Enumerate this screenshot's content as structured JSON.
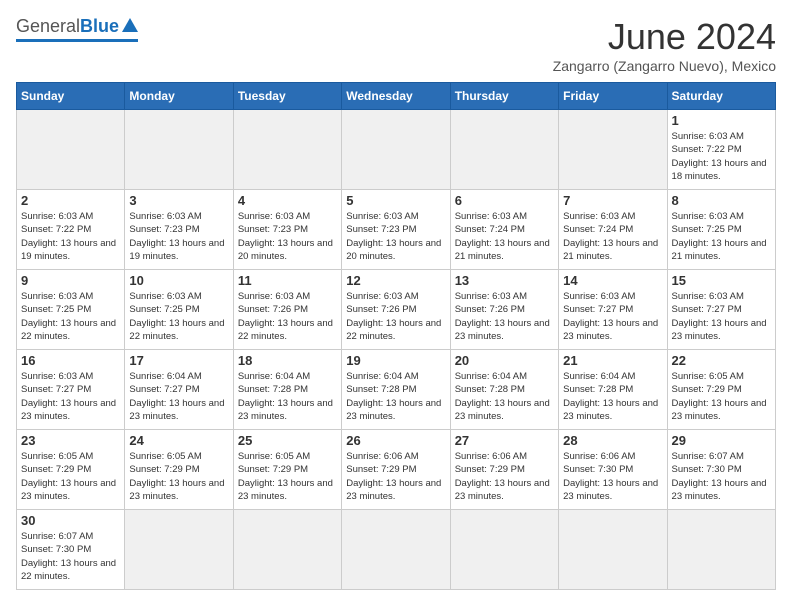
{
  "header": {
    "logo_general": "General",
    "logo_blue": "Blue",
    "title": "June 2024",
    "subtitle": "Zangarro (Zangarro Nuevo), Mexico"
  },
  "days_of_week": [
    "Sunday",
    "Monday",
    "Tuesday",
    "Wednesday",
    "Thursday",
    "Friday",
    "Saturday"
  ],
  "weeks": [
    [
      {
        "day": "",
        "info": ""
      },
      {
        "day": "",
        "info": ""
      },
      {
        "day": "",
        "info": ""
      },
      {
        "day": "",
        "info": ""
      },
      {
        "day": "",
        "info": ""
      },
      {
        "day": "",
        "info": ""
      },
      {
        "day": "1",
        "info": "Sunrise: 6:03 AM\nSunset: 7:22 PM\nDaylight: 13 hours and 18 minutes."
      }
    ],
    [
      {
        "day": "2",
        "info": "Sunrise: 6:03 AM\nSunset: 7:22 PM\nDaylight: 13 hours and 19 minutes."
      },
      {
        "day": "3",
        "info": "Sunrise: 6:03 AM\nSunset: 7:23 PM\nDaylight: 13 hours and 19 minutes."
      },
      {
        "day": "4",
        "info": "Sunrise: 6:03 AM\nSunset: 7:23 PM\nDaylight: 13 hours and 20 minutes."
      },
      {
        "day": "5",
        "info": "Sunrise: 6:03 AM\nSunset: 7:23 PM\nDaylight: 13 hours and 20 minutes."
      },
      {
        "day": "6",
        "info": "Sunrise: 6:03 AM\nSunset: 7:24 PM\nDaylight: 13 hours and 21 minutes."
      },
      {
        "day": "7",
        "info": "Sunrise: 6:03 AM\nSunset: 7:24 PM\nDaylight: 13 hours and 21 minutes."
      },
      {
        "day": "8",
        "info": "Sunrise: 6:03 AM\nSunset: 7:25 PM\nDaylight: 13 hours and 21 minutes."
      }
    ],
    [
      {
        "day": "9",
        "info": "Sunrise: 6:03 AM\nSunset: 7:25 PM\nDaylight: 13 hours and 22 minutes."
      },
      {
        "day": "10",
        "info": "Sunrise: 6:03 AM\nSunset: 7:25 PM\nDaylight: 13 hours and 22 minutes."
      },
      {
        "day": "11",
        "info": "Sunrise: 6:03 AM\nSunset: 7:26 PM\nDaylight: 13 hours and 22 minutes."
      },
      {
        "day": "12",
        "info": "Sunrise: 6:03 AM\nSunset: 7:26 PM\nDaylight: 13 hours and 22 minutes."
      },
      {
        "day": "13",
        "info": "Sunrise: 6:03 AM\nSunset: 7:26 PM\nDaylight: 13 hours and 23 minutes."
      },
      {
        "day": "14",
        "info": "Sunrise: 6:03 AM\nSunset: 7:27 PM\nDaylight: 13 hours and 23 minutes."
      },
      {
        "day": "15",
        "info": "Sunrise: 6:03 AM\nSunset: 7:27 PM\nDaylight: 13 hours and 23 minutes."
      }
    ],
    [
      {
        "day": "16",
        "info": "Sunrise: 6:03 AM\nSunset: 7:27 PM\nDaylight: 13 hours and 23 minutes."
      },
      {
        "day": "17",
        "info": "Sunrise: 6:04 AM\nSunset: 7:27 PM\nDaylight: 13 hours and 23 minutes."
      },
      {
        "day": "18",
        "info": "Sunrise: 6:04 AM\nSunset: 7:28 PM\nDaylight: 13 hours and 23 minutes."
      },
      {
        "day": "19",
        "info": "Sunrise: 6:04 AM\nSunset: 7:28 PM\nDaylight: 13 hours and 23 minutes."
      },
      {
        "day": "20",
        "info": "Sunrise: 6:04 AM\nSunset: 7:28 PM\nDaylight: 13 hours and 23 minutes."
      },
      {
        "day": "21",
        "info": "Sunrise: 6:04 AM\nSunset: 7:28 PM\nDaylight: 13 hours and 23 minutes."
      },
      {
        "day": "22",
        "info": "Sunrise: 6:05 AM\nSunset: 7:29 PM\nDaylight: 13 hours and 23 minutes."
      }
    ],
    [
      {
        "day": "23",
        "info": "Sunrise: 6:05 AM\nSunset: 7:29 PM\nDaylight: 13 hours and 23 minutes."
      },
      {
        "day": "24",
        "info": "Sunrise: 6:05 AM\nSunset: 7:29 PM\nDaylight: 13 hours and 23 minutes."
      },
      {
        "day": "25",
        "info": "Sunrise: 6:05 AM\nSunset: 7:29 PM\nDaylight: 13 hours and 23 minutes."
      },
      {
        "day": "26",
        "info": "Sunrise: 6:06 AM\nSunset: 7:29 PM\nDaylight: 13 hours and 23 minutes."
      },
      {
        "day": "27",
        "info": "Sunrise: 6:06 AM\nSunset: 7:29 PM\nDaylight: 13 hours and 23 minutes."
      },
      {
        "day": "28",
        "info": "Sunrise: 6:06 AM\nSunset: 7:30 PM\nDaylight: 13 hours and 23 minutes."
      },
      {
        "day": "29",
        "info": "Sunrise: 6:07 AM\nSunset: 7:30 PM\nDaylight: 13 hours and 23 minutes."
      }
    ],
    [
      {
        "day": "30",
        "info": "Sunrise: 6:07 AM\nSunset: 7:30 PM\nDaylight: 13 hours and 22 minutes."
      },
      {
        "day": "",
        "info": ""
      },
      {
        "day": "",
        "info": ""
      },
      {
        "day": "",
        "info": ""
      },
      {
        "day": "",
        "info": ""
      },
      {
        "day": "",
        "info": ""
      },
      {
        "day": "",
        "info": ""
      }
    ]
  ]
}
